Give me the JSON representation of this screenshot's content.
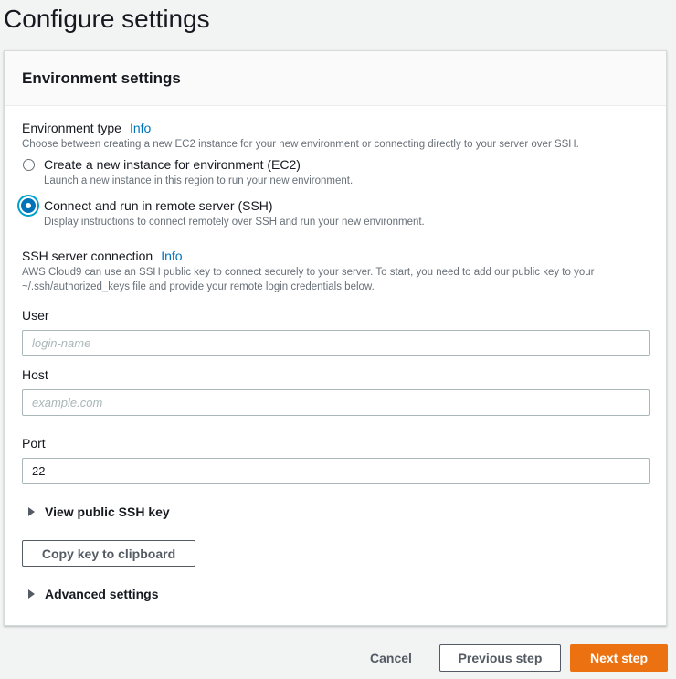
{
  "page": {
    "title": "Configure settings"
  },
  "panel": {
    "title": "Environment settings"
  },
  "environment_type": {
    "label": "Environment type",
    "info": "Info",
    "description": "Choose between creating a new EC2 instance for your new environment or connecting directly to your server over SSH.",
    "options": [
      {
        "label": "Create a new instance for environment (EC2)",
        "description": "Launch a new instance in this region to run your new environment.",
        "selected": false
      },
      {
        "label": "Connect and run in remote server (SSH)",
        "description": "Display instructions to connect remotely over SSH and run your new environment.",
        "selected": true
      }
    ]
  },
  "ssh": {
    "label": "SSH server connection",
    "info": "Info",
    "description_line1": "AWS Cloud9 can use an SSH public key to connect securely to your server. To start, you need to add our public key to your",
    "description_line2": "~/.ssh/authorized_keys file and provide your remote login credentials below."
  },
  "fields": {
    "user": {
      "label": "User",
      "placeholder": "login-name",
      "value": ""
    },
    "host": {
      "label": "Host",
      "placeholder": "example.com",
      "value": ""
    },
    "port": {
      "label": "Port",
      "placeholder": "",
      "value": "22"
    }
  },
  "public_key": {
    "expander_label": "View public SSH key",
    "copy_button": "Copy key to clipboard"
  },
  "advanced": {
    "expander_label": "Advanced settings"
  },
  "footer": {
    "cancel": "Cancel",
    "previous": "Previous step",
    "next": "Next step"
  },
  "colors": {
    "accent": "#0073bb",
    "primary_button": "#ec7211",
    "background": "#f2f3f3"
  }
}
